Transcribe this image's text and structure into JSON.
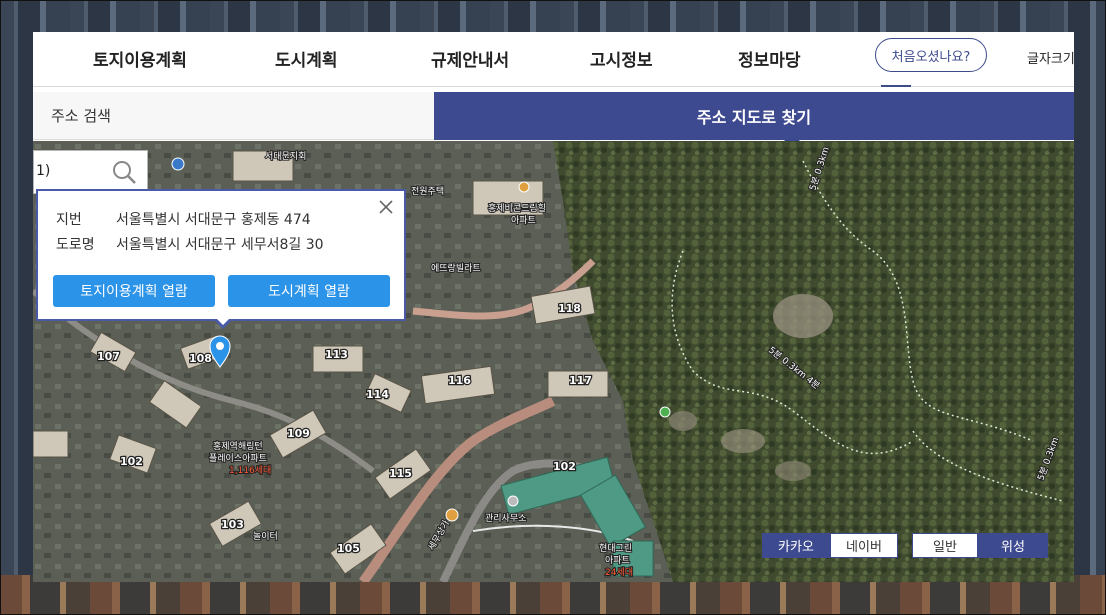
{
  "nav": {
    "items": [
      "토지이용계획",
      "도시계획",
      "규제안내서",
      "고시정보",
      "정보마당"
    ],
    "first_visit_button": "처음오셨나요?",
    "font_size_label": "글자크기"
  },
  "tabs": {
    "search": "주소 검색",
    "map": "주소 지도로 찾기"
  },
  "search": {
    "value": "1)"
  },
  "popup": {
    "jibun_label": "지번",
    "jibun_value": "서울특별시 서대문구 홍제동 474",
    "road_label": "도로명",
    "road_value": "서울특별시 서대문구 세무서8길 30",
    "btn_land_use": "토지이용계획 열람",
    "btn_urban_plan": "도시계획 열람"
  },
  "map_labels": {
    "church": "서대문지회",
    "house": "전원주택",
    "apt_hill_1": "홍제비콘드림힐",
    "apt_hill_2": "아파트",
    "villa": "에뜨랑빌라트",
    "apt_complex_1": "홍제역해링턴",
    "apt_complex_2": "플레이스아파트",
    "apt_complex_units": "1,116세대",
    "office": "관리사무소",
    "shop": "세무상가",
    "hyundai_1": "현대그린",
    "hyundai_2": "아파트",
    "hyundai_units": "24세대",
    "playground": "놀이터",
    "trail_1": "5분 0.3km",
    "trail_2": "5분 0.3km 4분",
    "trail_3": "5분 0.3km",
    "buildings": [
      "107",
      "108",
      "113",
      "118",
      "116",
      "117",
      "114",
      "109",
      "102",
      "115",
      "103",
      "105",
      "102"
    ]
  },
  "map_toggle": {
    "kakao": "카카오",
    "naver": "네이버",
    "normal": "일반",
    "satellite": "위성"
  },
  "colors": {
    "brand": "#3e4a8f",
    "button_blue": "#2b93e8"
  }
}
